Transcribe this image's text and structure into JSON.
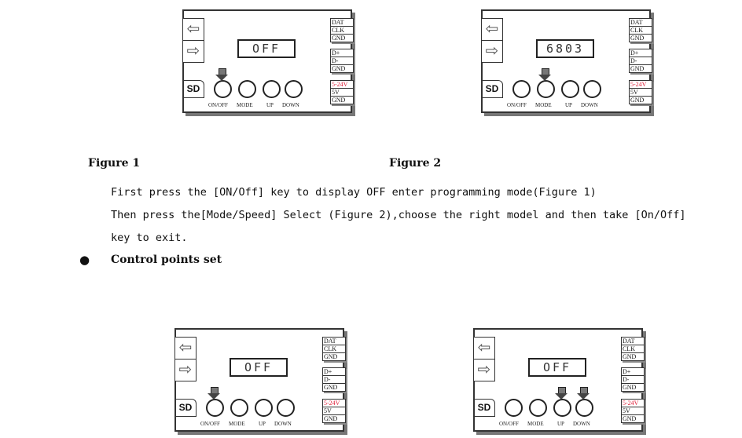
{
  "devices": [
    {
      "display": "OFF",
      "pointer_on": [
        "ON/OFF"
      ]
    },
    {
      "display": "6803",
      "pointer_on": [
        "MODE"
      ]
    },
    {
      "display": "OFF",
      "pointer_on": [
        "ON/OFF"
      ]
    },
    {
      "display": "OFF",
      "pointer_on": [
        "UP",
        "DOWN"
      ]
    }
  ],
  "device_labels": {
    "sd": "SD",
    "left_arrow": "⇦",
    "right_arrow": "⇨",
    "buttons": [
      "ON/OFF",
      "MODE",
      "UP",
      "DOWN"
    ],
    "terminals": [
      [
        "DAT",
        "CLK",
        "GND"
      ],
      [
        "D+",
        "D-",
        "GND"
      ],
      [
        "5-24V",
        "5V",
        "GND"
      ]
    ],
    "highlight_color": "#e0203a"
  },
  "captions": {
    "figure1": "Figure 1",
    "figure2": "Figure 2"
  },
  "paragraph": [
    "First press the [ON/Off] key to display OFF enter programming mode(Figure 1)",
    "Then press the[Mode/Speed] Select (Figure 2),choose the right model and then take [On/Off]",
    "key to exit."
  ],
  "bullet": {
    "symbol": "●",
    "text": "Control points set"
  }
}
